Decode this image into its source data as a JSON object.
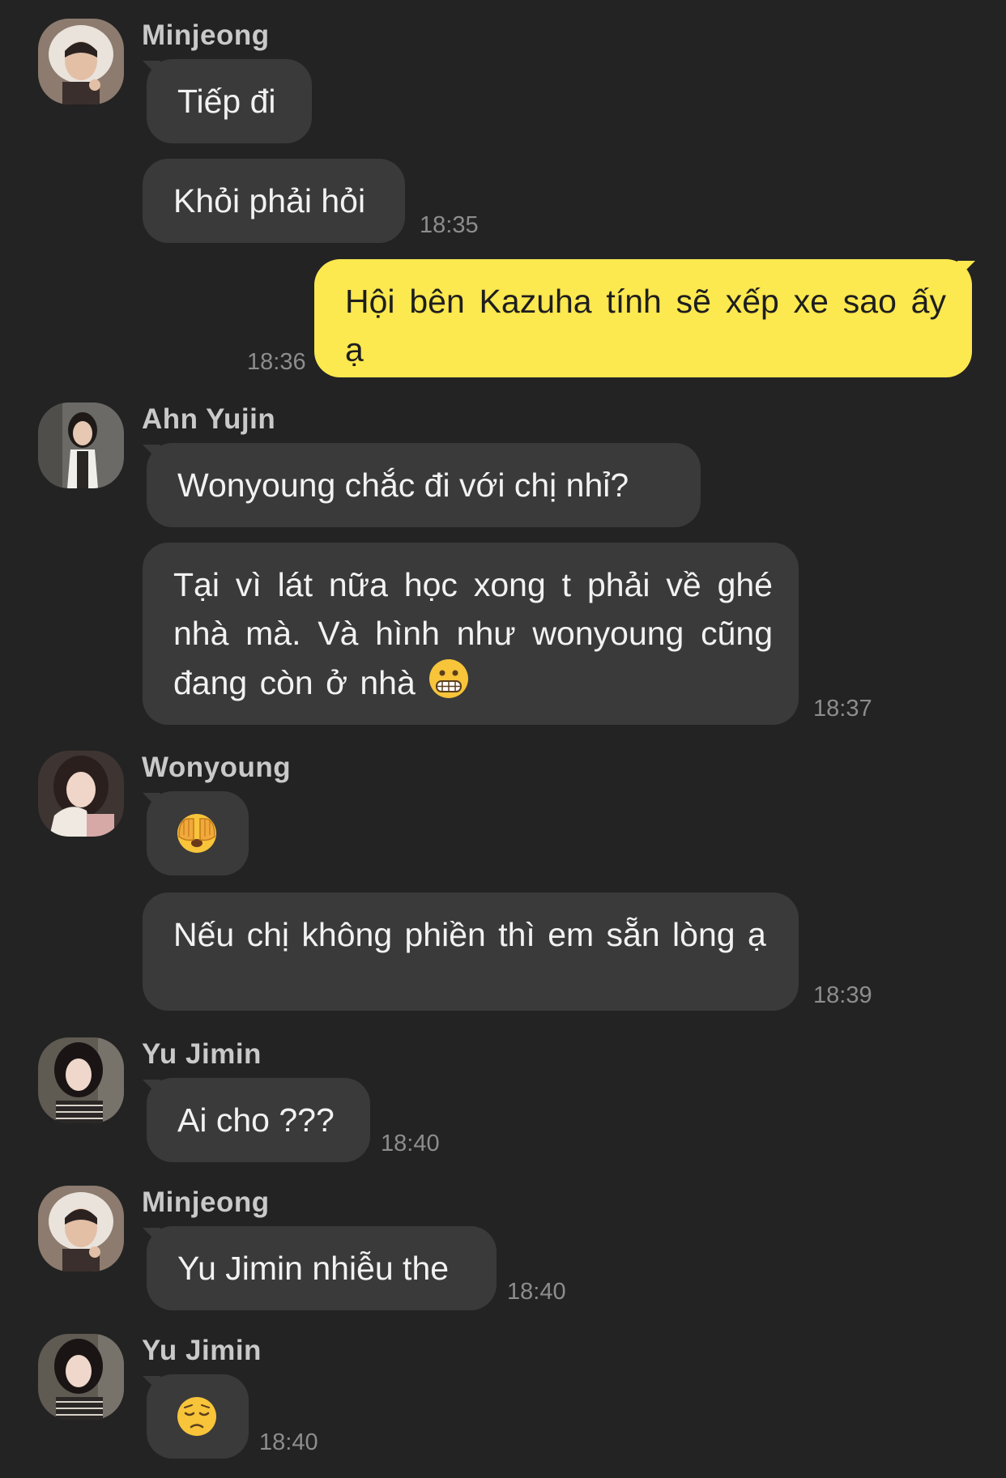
{
  "colors": {
    "background": "#232323",
    "bubble_other": "#3a3a3a",
    "bubble_mine": "#fce84f",
    "text_light": "#f2f2f2",
    "timestamp": "#8d8d8d"
  },
  "messages": [
    {
      "sender": "Minjeong",
      "avatar": "avatar-minjeong",
      "bubbles": [
        {
          "text": "Tiếp đi"
        },
        {
          "text": "Khỏi phải hỏi",
          "time": "18:35"
        }
      ]
    },
    {
      "mine": true,
      "text": "Hội bên Kazuha tính sẽ xếp xe sao ấy ạ",
      "time": "18:36"
    },
    {
      "sender": "Ahn Yujin",
      "avatar": "avatar-yujin",
      "bubbles": [
        {
          "text": "Wonyoung chắc đi với chị nhỉ?"
        },
        {
          "text": "Tại vì lát nữa học xong t phải về ghé nhà mà. Và hình như wonyoung cũng đang còn ở nhà",
          "emoji": "grimacing-face-emoji",
          "time": "18:37"
        }
      ]
    },
    {
      "sender": "Wonyoung",
      "avatar": "avatar-wonyoung",
      "bubbles": [
        {
          "emoji": "face-with-hands-over-eyes-emoji"
        },
        {
          "text": "Nếu chị không phiền thì em sẵn lòng ạ",
          "time": "18:39"
        }
      ]
    },
    {
      "sender": "Yu Jimin",
      "avatar": "avatar-jimin",
      "bubbles": [
        {
          "text": "Ai cho ???",
          "time": "18:40"
        }
      ]
    },
    {
      "sender": "Minjeong",
      "avatar": "avatar-minjeong",
      "bubbles": [
        {
          "text": "Yu Jimin nhiễu the",
          "time": "18:40"
        }
      ]
    },
    {
      "sender": "Yu Jimin",
      "avatar": "avatar-jimin",
      "bubbles": [
        {
          "emoji": "pensive-face-emoji",
          "time": "18:40"
        }
      ]
    }
  ]
}
